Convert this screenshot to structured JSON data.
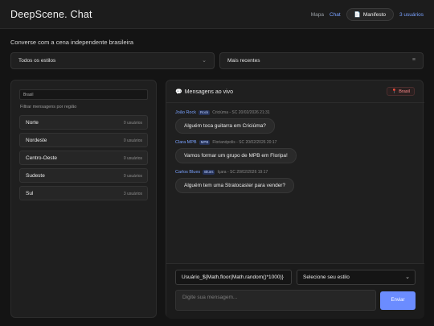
{
  "header": {
    "brand": "DeepScene. Chat",
    "nav": {
      "map": "Mapa",
      "chat": "Chat",
      "manifesto": "Manifesto",
      "users": "3 usuários"
    }
  },
  "subtitle": "Converse com a cena independente brasileira",
  "filters": {
    "style": "Todos os estilos",
    "sort": "Mais recentes"
  },
  "regions": {
    "search_value": "Brasil",
    "filter_label": "Filtrar mensagens por região",
    "items": [
      {
        "name": "Norte",
        "count": "0 usuários"
      },
      {
        "name": "Nordeste",
        "count": "0 usuários"
      },
      {
        "name": "Centro-Oeste",
        "count": "0 usuários"
      },
      {
        "name": "Sudeste",
        "count": "0 usuários"
      },
      {
        "name": "Sul",
        "count": "3 usuários"
      }
    ]
  },
  "feed": {
    "title": "Mensagens ao vivo",
    "location": "Brasil",
    "messages": [
      {
        "user": "João Rock",
        "tag": "Rock",
        "meta": "Criciúma - SC  20/02/2026 21:31",
        "text": "Alguém toca guitarra em Criciúma?"
      },
      {
        "user": "Clara MPB",
        "tag": "MPB",
        "meta": "Florianópolis - SC  20/02/2026 20:17",
        "text": "Vamos formar um grupo de MPB em Floripa!"
      },
      {
        "user": "Carlos Blues",
        "tag": "Blues",
        "meta": "Içara - SC  20/02/2026 19:17",
        "text": "Alguém tem uma Stratocaster para vender?"
      }
    ]
  },
  "compose": {
    "username_value": "Usuário_${Math.floor(Math.random()*1000)}",
    "style_placeholder": "Selecione seu estilo",
    "message_placeholder": "Digite sua mensagem...",
    "send_label": "Enviar"
  },
  "colors": {
    "accent": "#6b8cff",
    "link": "#7aa2ff",
    "location": "#ff8a8a"
  },
  "icons": {
    "chat": "chat-icon",
    "pin": "pin-icon",
    "document": "document-icon"
  }
}
